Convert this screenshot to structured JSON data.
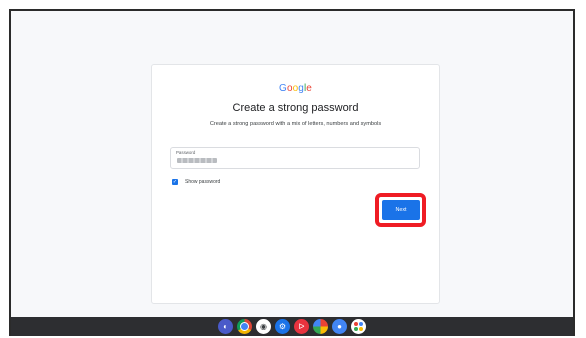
{
  "logo": {
    "letters": [
      {
        "char": "G",
        "color": "#4285f4"
      },
      {
        "char": "o",
        "color": "#ea4335"
      },
      {
        "char": "o",
        "color": "#fbbc05"
      },
      {
        "char": "g",
        "color": "#4285f4"
      },
      {
        "char": "l",
        "color": "#34a853"
      },
      {
        "char": "e",
        "color": "#ea4335"
      }
    ]
  },
  "page": {
    "title": "Create a strong password",
    "subtitle": "Create a strong password with a mix of letters, numbers and symbols"
  },
  "password_field": {
    "label": "Password",
    "value_masked": true
  },
  "show_password": {
    "label": "Show password",
    "checked": true,
    "check_glyph": "✓"
  },
  "next_button": {
    "label": "Next",
    "highlighted": true,
    "highlight_color": "#ef1c24",
    "color": "#1a73e8"
  },
  "shelf": {
    "apps": [
      {
        "name": "launcher-icon",
        "glyph": "◐"
      },
      {
        "name": "chrome-icon",
        "glyph": ""
      },
      {
        "name": "camera-icon",
        "glyph": "◉"
      },
      {
        "name": "settings-icon",
        "glyph": "⚙"
      },
      {
        "name": "play-store-icon",
        "glyph": "ᐅ"
      },
      {
        "name": "photos-icon",
        "glyph": ""
      },
      {
        "name": "assistant-icon",
        "glyph": "●"
      },
      {
        "name": "app-grid-icon",
        "glyph": ""
      }
    ]
  }
}
